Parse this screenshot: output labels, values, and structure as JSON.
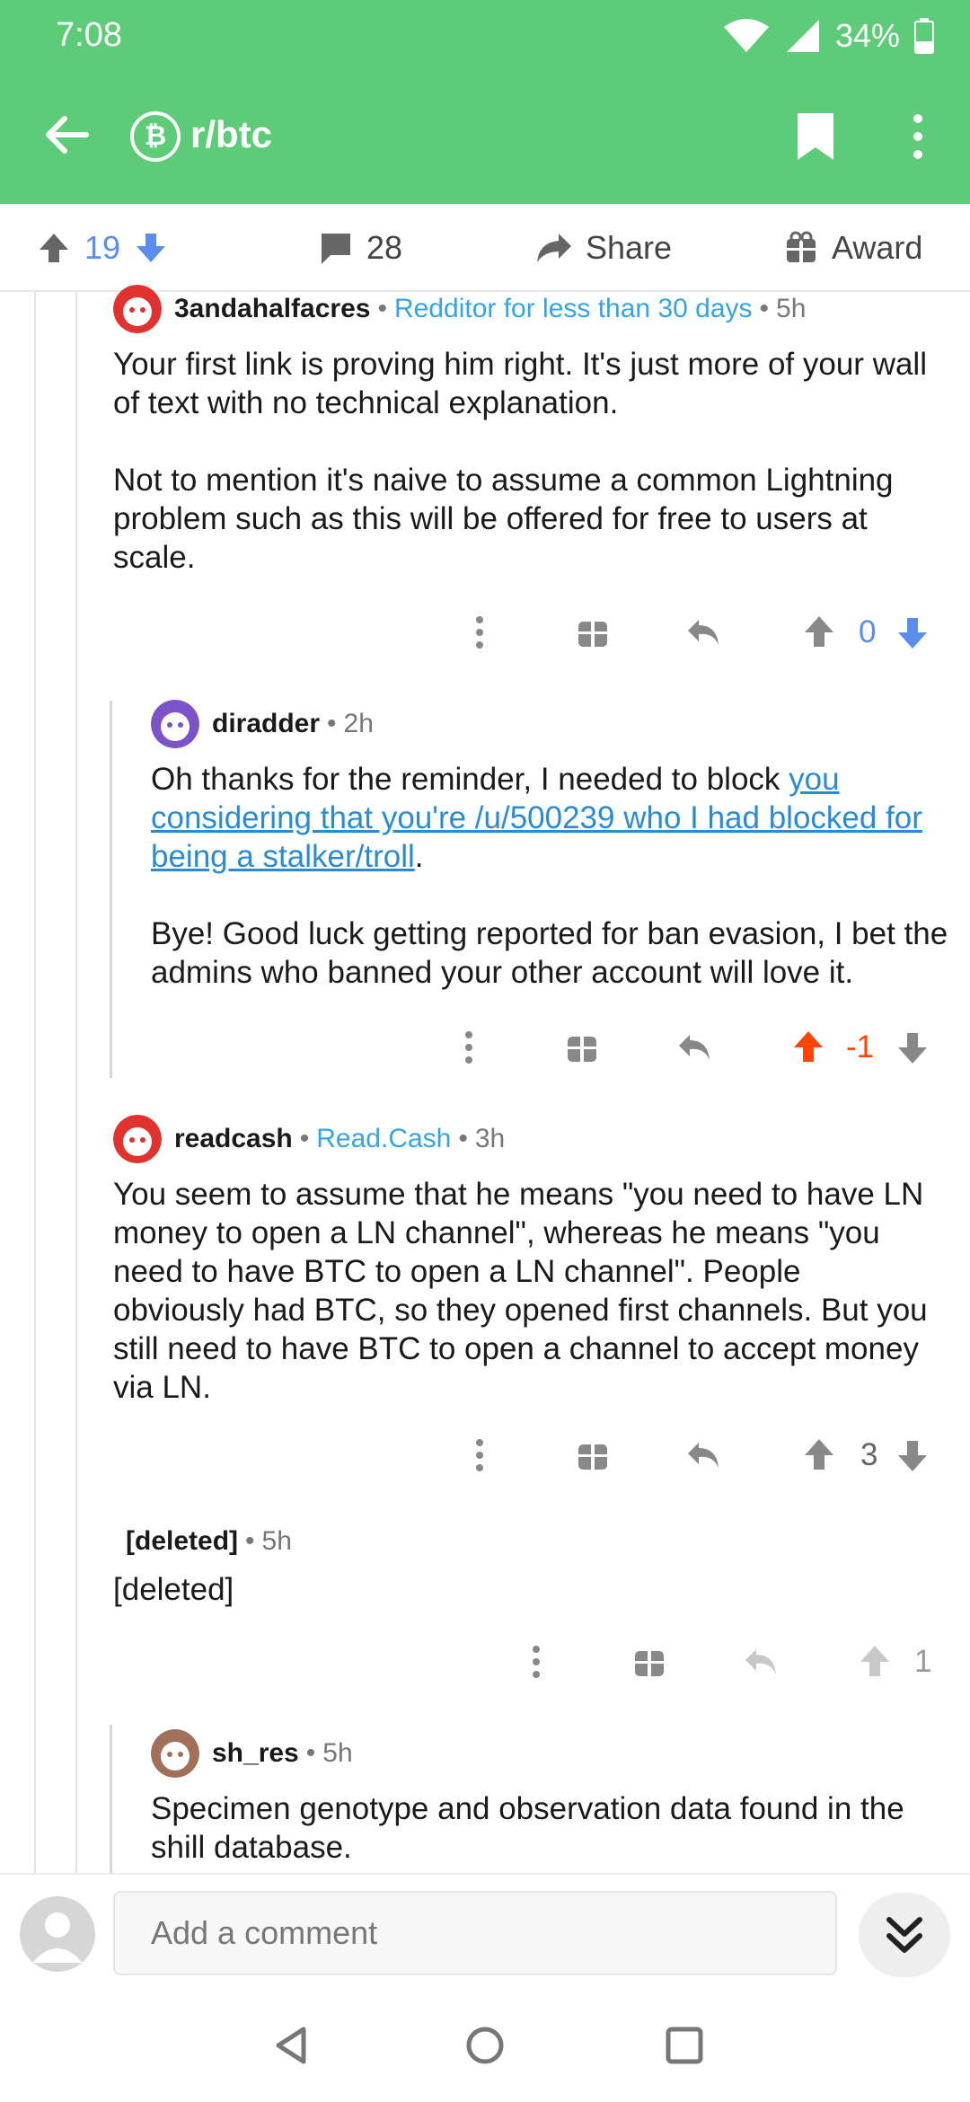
{
  "status": {
    "time": "7:08",
    "battery": "34%"
  },
  "header": {
    "subreddit": "r/btc",
    "sub_icon": "bitcoin-icon"
  },
  "action_bar": {
    "votes": "19",
    "comments": "28",
    "share_label": "Share",
    "award_label": "Award"
  },
  "comments": [
    {
      "author": "3andahalfacres",
      "flair": "Redditor for less than 30 days",
      "age": "5h",
      "paragraphs": [
        "Your first link is proving him right. It's just more of your wall of text with no technical explanation.",
        "Not to mention it's naive to assume a common Lightning problem such as this will be offered for free to users at scale."
      ],
      "score": "0"
    },
    {
      "author": "diradder",
      "age": "2h",
      "p1_before": "Oh thanks for the reminder, I needed to block ",
      "p1_link": "you considering that you're /u/500239 who I had blocked for being a stalker/troll",
      "p1_after": ".",
      "p2": "Bye! Good luck getting reported for ban evasion, I bet the admins who banned your other account will love it.",
      "score": "-1",
      "upvote_color": "#ff4500"
    },
    {
      "author": "readcash",
      "flair": "Read.Cash",
      "age": "3h",
      "paragraphs": [
        "You seem to assume that he means \"you need to have LN money to open a LN channel\", whereas he means \"you need to have BTC to open a LN channel\". People obviously had BTC, so they opened first channels. But you still need to have BTC to open a channel to accept money via LN."
      ],
      "score": "3"
    },
    {
      "author": "[deleted]",
      "age": "5h",
      "paragraphs": [
        "[deleted]"
      ],
      "score": "1"
    },
    {
      "author": "sh_res",
      "age": "5h",
      "paragraphs": [
        "Specimen genotype and observation data found in the shill database."
      ]
    }
  ],
  "comment_bar": {
    "placeholder": "Add a comment"
  },
  "colors": {
    "header_green": "#5ecb78",
    "vote_blue": "#5b8dee",
    "flair_blue": "#34a4e3",
    "upvote_orange": "#ff4500"
  }
}
